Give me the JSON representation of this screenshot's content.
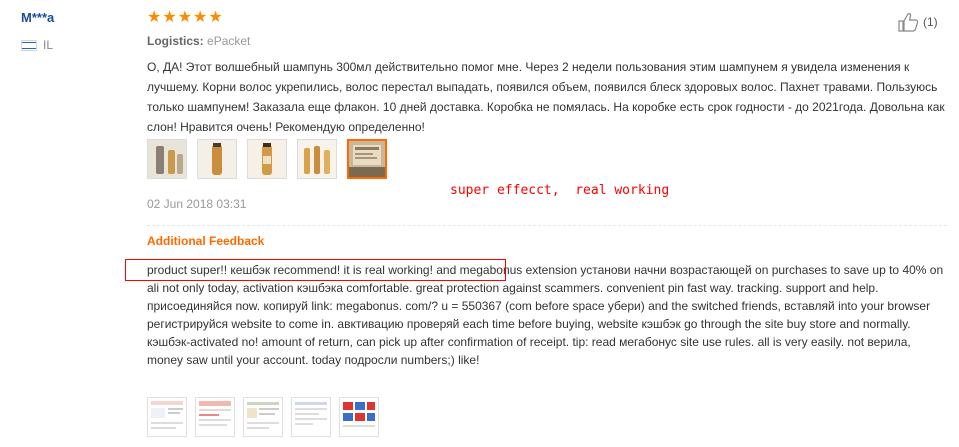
{
  "reviewer": {
    "name": "M***a",
    "country": "IL"
  },
  "rating": {
    "stars": 5,
    "max": 5,
    "color": "#ff8a00"
  },
  "helpful": {
    "count_label": "(1)",
    "icon": "thumbs-up-icon"
  },
  "logistics": {
    "label": "Logistics:",
    "value": "ePacket"
  },
  "review": {
    "text": "О, ДА! Этот волшебный шампунь 300мл действительно помог мне. Через 2 недели пользования этим шампунем я увидела изменения к лучшему. Корни волос укрепились, волос перестал выпадать, появился объем, появился блеск здоровых волос. Пахнет травами. Пользуюсь только шампунем! Заказала еще флакон. 10 дней доставка. Коробка не помялась. На коробке есть срок годности - до 2021года. Довольна как слон! Нравится очень! Рекомендую определенно!",
    "date": "02 Jun 2018 03:31",
    "photo_count": 5
  },
  "annotation": {
    "text": "super effecct,  real working",
    "color": "#ff0000"
  },
  "additional_feedback": {
    "title": "Additional Feedback",
    "text": "product super!! кешбэк recommend! it is real working! and megabonus extension установи начни возрастающей on purchases to save up to 40% on ali not only today, activation кэшбэка comfortable. great protection against scammers. convenient pin fast way. tracking. support and help. присоединяйся now. копируй link: megabonus. com/? u = 550367 (com before space убери) and the switched friends, вставляй into your browser регистрируйся website to come in. авктивацию проверяй each time before buying, website кэшбэк go through the site buy store and normally. кэшбэк-activated no! amount of return, can pick up after confirmation of receipt. tip: read мегабонус site use rules. all is very easily. not верила, money saw until your account. today подросли numbers;) like!",
    "photo_count": 5
  },
  "colors": {
    "accent": "#ff6a00",
    "name": "#1a4d9c"
  }
}
